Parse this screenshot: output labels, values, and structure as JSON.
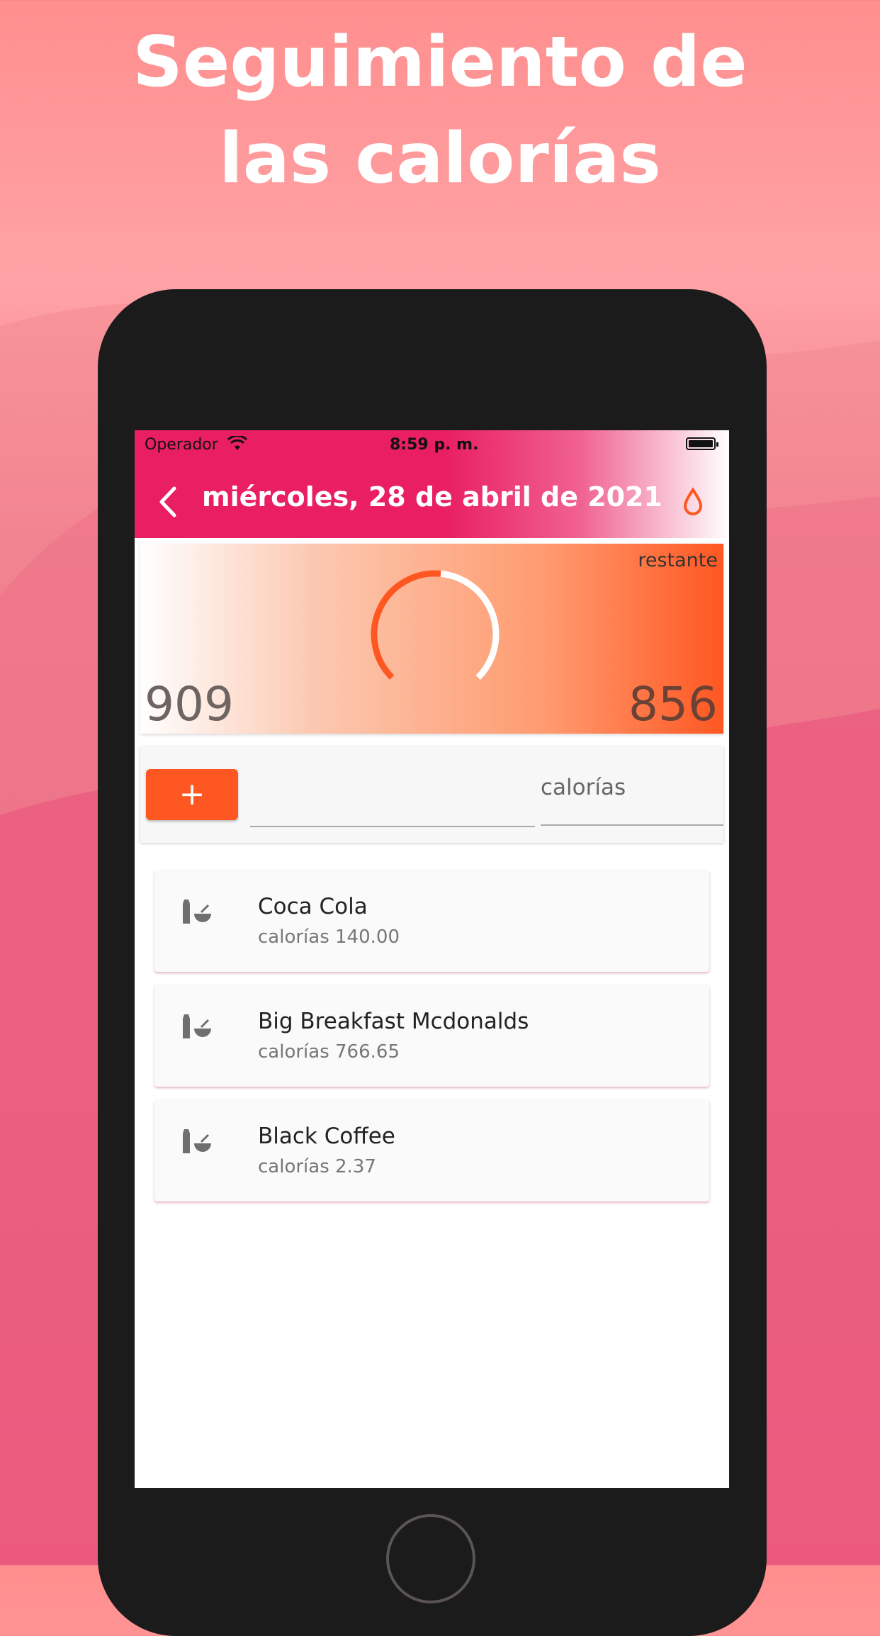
{
  "promo": {
    "headline_line1": "Seguimiento de",
    "headline_line2": "las calorías"
  },
  "status_bar": {
    "carrier": "Operador",
    "time": "8:59 p. m."
  },
  "header": {
    "title": "miércoles, 28 de abril de 2021",
    "back_icon": "chevron-left-icon",
    "water_icon": "water-drop-icon"
  },
  "summary": {
    "label": "restante",
    "consumed": "909",
    "remaining": "856",
    "gauge_fraction": 0.52
  },
  "add_entry": {
    "add_label": "+",
    "calories_placeholder": "calorías"
  },
  "food_items": [
    {
      "name": "Coca Cola",
      "calories": "calorías 140.00"
    },
    {
      "name": "Big Breakfast Mcdonalds",
      "calories": "calorías 766.65"
    },
    {
      "name": "Black Coffee",
      "calories": "calorías 2.37"
    }
  ],
  "colors": {
    "header_pink": "#e91e63",
    "accent_orange": "#ff5722"
  }
}
